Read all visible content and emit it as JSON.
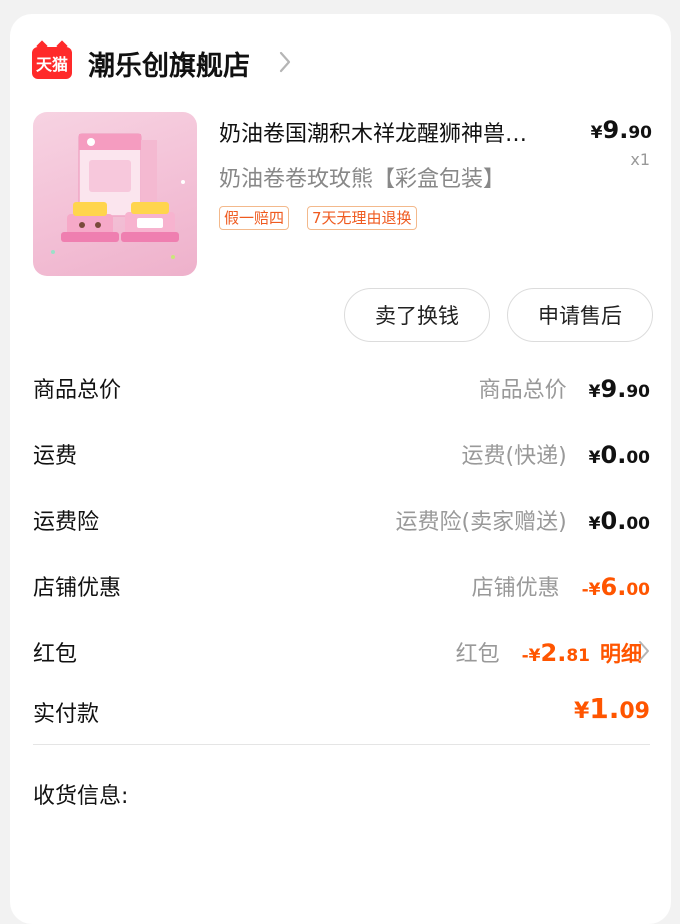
{
  "shop": {
    "logo_text": "天猫",
    "name": "潮乐创旗舰店",
    "icon": "chevron-right-icon"
  },
  "product": {
    "title": "奶油卷国潮积木祥龙醒狮神兽…",
    "sku": "奶油卷卷玫玫熊【彩盒包装】",
    "price_symbol": "¥",
    "price_int": "9.",
    "price_dec": "90",
    "quantity": "x1",
    "tags": [
      "假一赔四",
      "7天无理由退换"
    ],
    "image": "pink-building-block-box-product-photo"
  },
  "actions": {
    "sell_label": "卖了换钱",
    "aftersale_label": "申请售后"
  },
  "summary": {
    "goods_total": {
      "label": "商品总价",
      "sub": "商品总价",
      "sym": "¥",
      "int": "9.",
      "dec": "90"
    },
    "shipping": {
      "label": "运费",
      "sub": "运费(快递)",
      "sym": "¥",
      "int": "0.",
      "dec": "00"
    },
    "shipping_insurance": {
      "label": "运费险",
      "sub": "运费险(卖家赠送)",
      "sym": "¥",
      "int": "0.",
      "dec": "00"
    },
    "shop_discount": {
      "label": "店铺优惠",
      "sub": "店铺优惠",
      "sym": "-¥",
      "int": "6.",
      "dec": "00"
    },
    "red_packet": {
      "label": "红包",
      "sub": "红包",
      "sym": "-¥",
      "int": "2.",
      "dec": "81",
      "detail": "明细"
    },
    "paid": {
      "label": "实付款",
      "sym": "¥",
      "int": "1.",
      "dec": "09"
    }
  },
  "receiving": {
    "label": "收货信息:"
  },
  "colors": {
    "accent": "#ff5500",
    "tmall_red": "#ff2a2a",
    "tag_border": "#f3b98c",
    "muted_text": "#999999",
    "background": "#f2f2f2"
  }
}
